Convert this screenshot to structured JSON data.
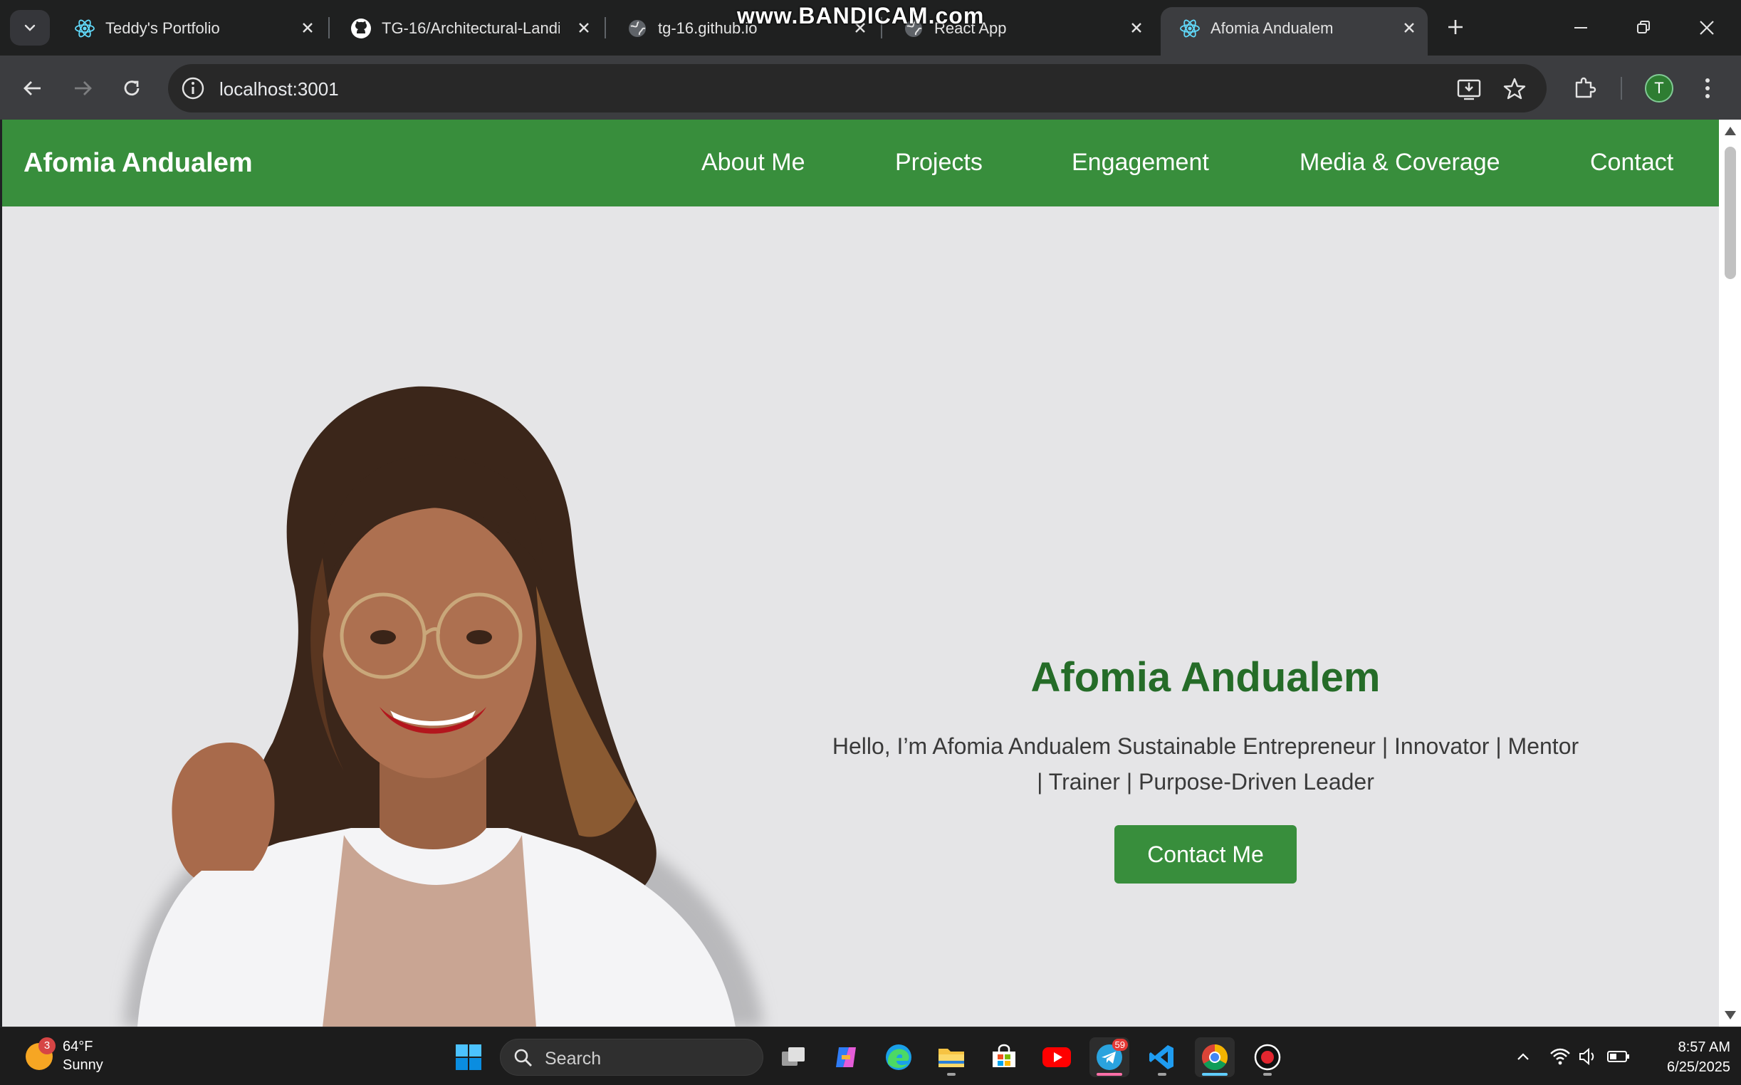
{
  "browser": {
    "tabs": [
      {
        "title": "Teddy's Portfolio",
        "icon": "react-icon",
        "active": false
      },
      {
        "title": "TG-16/Architectural-Landi",
        "icon": "github-icon",
        "active": false
      },
      {
        "title": "tg-16.github.io",
        "icon": "globe-icon",
        "active": false
      },
      {
        "title": "React App",
        "icon": "globe-icon",
        "active": false
      },
      {
        "title": "Afomia Andualem",
        "icon": "react-icon",
        "active": true
      }
    ],
    "watermark": "www.BANDICAM.com",
    "url": "localhost:3001",
    "profile_initial": "T"
  },
  "site": {
    "brand": "Afomia Andualem",
    "nav": [
      "About Me",
      "Projects",
      "Engagement",
      "Media & Coverage",
      "Contact"
    ],
    "hero": {
      "name": "Afomia Andualem",
      "tagline": "Hello, I’m Afomia Andualem Sustainable Entrepreneur | Innovator | Mentor | Trainer | Purpose-Driven Leader",
      "button": "Contact Me"
    }
  },
  "taskbar": {
    "weather": {
      "temp": "64°F",
      "condition": "Sunny",
      "badge": "3"
    },
    "search_placeholder": "Search",
    "telegram_badge": "59",
    "time": "8:57 AM",
    "date": "6/25/2025"
  },
  "colors": {
    "brand_green": "#388e3c",
    "heading_green": "#256c28",
    "page_bg": "#e5e5e7"
  }
}
